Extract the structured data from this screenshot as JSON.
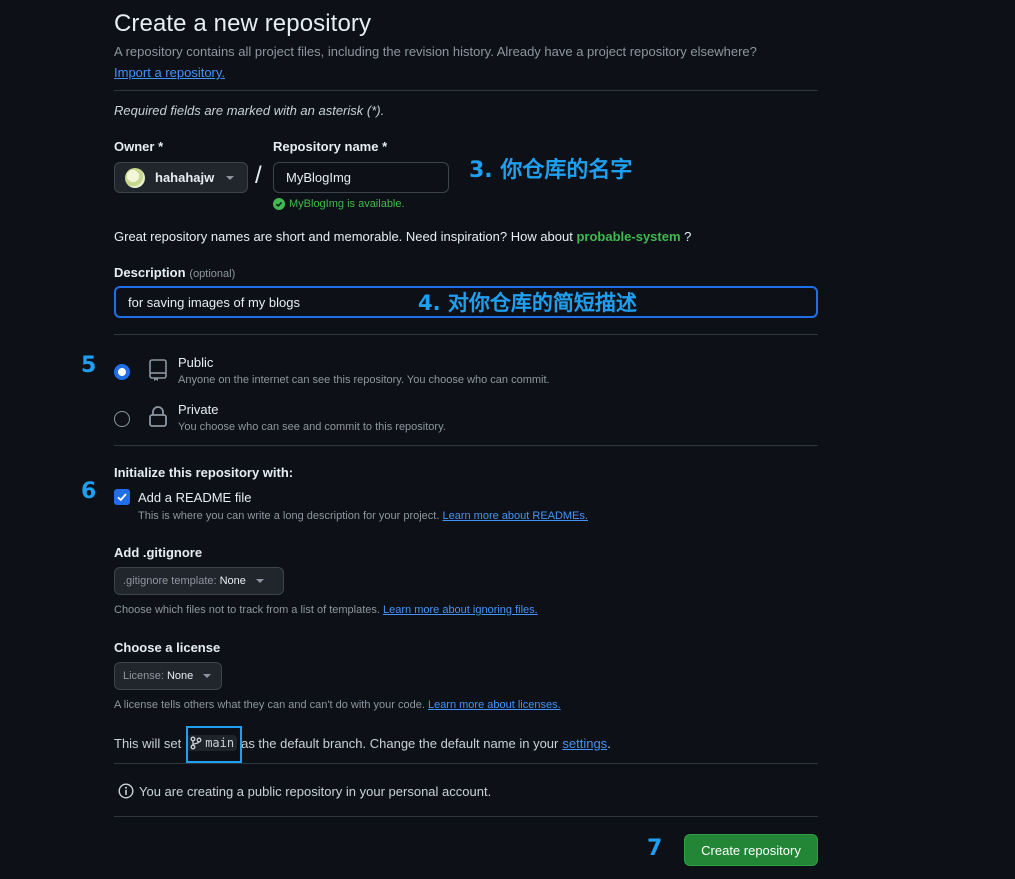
{
  "header": {
    "title": "Create a new repository",
    "subtitle": "A repository contains all project files, including the revision history. Already have a project repository elsewhere?",
    "import_link": "Import a repository."
  },
  "required_note": "Required fields are marked with an asterisk (*).",
  "owner": {
    "label": "Owner *",
    "value": "hahahajw"
  },
  "repo_name": {
    "label": "Repository name *",
    "value": "MyBlogImg",
    "availability": "MyBlogImg is available."
  },
  "inspiration": {
    "text": "Great repository names are short and memorable. Need inspiration? How about",
    "suggestion": "probable-system",
    "tail": "?"
  },
  "description": {
    "label": "Description",
    "optional": "(optional)",
    "value": "for saving images of my blogs"
  },
  "visibility": {
    "public_title": "Public",
    "public_desc": "Anyone on the internet can see this repository. You choose who can commit.",
    "private_title": "Private",
    "private_desc": "You choose who can see and commit to this repository.",
    "selected": "public"
  },
  "init": {
    "heading": "Initialize this repository with:",
    "readme_label": "Add a README file",
    "readme_checked": true,
    "readme_desc": "This is where you can write a long description for your project.",
    "readme_link": "Learn more about READMEs."
  },
  "gitignore": {
    "heading": "Add .gitignore",
    "select_prefix": ".gitignore template:",
    "select_value": "None",
    "desc": "Choose which files not to track from a list of templates.",
    "link": "Learn more about ignoring files."
  },
  "license": {
    "heading": "Choose a license",
    "select_prefix": "License:",
    "select_value": "None",
    "desc": "A license tells others what they can and can't do with your code.",
    "link": "Learn more about licenses."
  },
  "branch": {
    "prefix": "This will set",
    "name": "main",
    "suffix": "as the default branch. Change the default name in your",
    "settings_link": "settings",
    "period": "."
  },
  "notice": "You are creating a public repository in your personal account.",
  "submit": "Create repository",
  "annotations": {
    "a3": "3. 你仓库的名字",
    "a4": "4. 对你仓库的简短描述",
    "a5": "5",
    "a6": "6",
    "a7": "7"
  },
  "colors": {
    "background": "#0d1117",
    "accent_blue": "#1f6feb",
    "success_green": "#3fb950",
    "button_green": "#238636",
    "annotation_blue": "#1f9ff0"
  }
}
